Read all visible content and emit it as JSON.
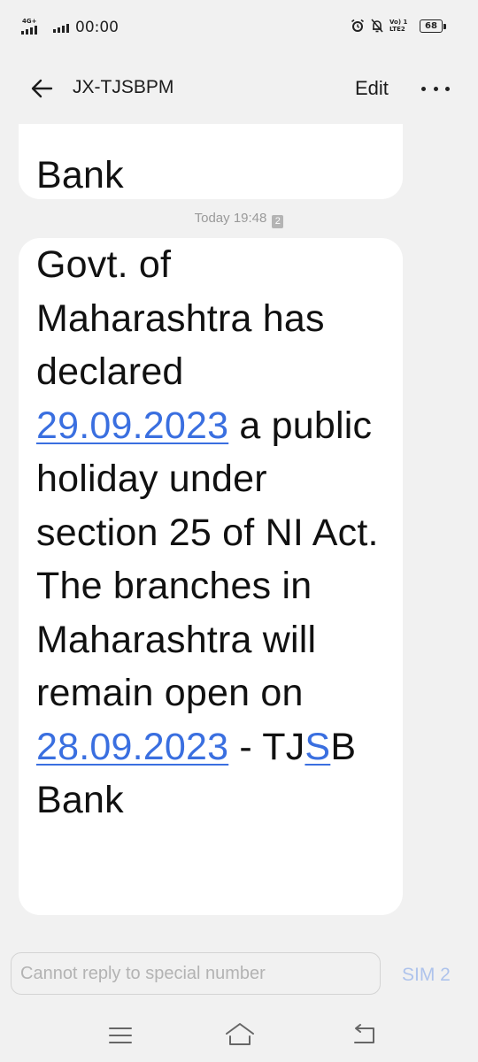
{
  "status_bar": {
    "network_type": "4G+",
    "time": "00:00",
    "volte_label": "Vo) 1 LTE2",
    "battery": "68"
  },
  "header": {
    "title": "JX-TJSBPM",
    "edit_label": "Edit"
  },
  "messages": {
    "previous_tail": "Bank",
    "timestamp": "Today 19:48",
    "sim_badge": "2",
    "main": {
      "part1": "Govt. of Maharashtra has declared ",
      "date1": "29.09.2023",
      "part2": " a public holiday under section 25 of NI Act. The branches in Maharashtra will remain open on ",
      "date2": "28.09.2023",
      "part3": " - TJ",
      "part4": "S",
      "part5": "B Bank"
    }
  },
  "reply": {
    "placeholder": "Cannot reply to special number",
    "sim_label": "SIM 2"
  },
  "navbar": {
    "icons": [
      "menu-icon",
      "home-icon",
      "back-icon"
    ]
  }
}
